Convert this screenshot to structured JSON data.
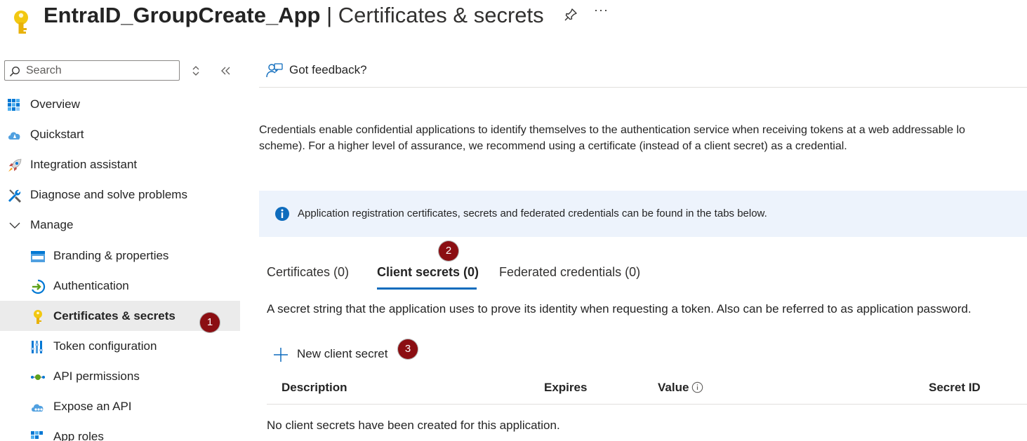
{
  "header": {
    "app_name": "EntraID_GroupCreate_App",
    "separator": " | ",
    "page_title": "Certificates & secrets",
    "more": "···",
    "icons": {
      "key": "key-icon",
      "pin": "pin-icon",
      "more": "more-icon"
    }
  },
  "sidebar": {
    "search": {
      "placeholder": "Search",
      "value": ""
    },
    "items": [
      {
        "label": "Overview",
        "icon": "overview-grid-icon"
      },
      {
        "label": "Quickstart",
        "icon": "quickstart-cloud-icon"
      },
      {
        "label": "Integration assistant",
        "icon": "rocket-icon"
      },
      {
        "label": "Diagnose and solve problems",
        "icon": "wrench-icon"
      },
      {
        "label": "Manage",
        "icon": "chevron-down-icon"
      },
      {
        "label": "Branding & properties",
        "icon": "branding-www-icon"
      },
      {
        "label": "Authentication",
        "icon": "authentication-icon"
      },
      {
        "label": "Certificates & secrets",
        "icon": "key-icon",
        "selected": true
      },
      {
        "label": "Token configuration",
        "icon": "token-bars-icon"
      },
      {
        "label": "API permissions",
        "icon": "api-permissions-icon"
      },
      {
        "label": "Expose an API",
        "icon": "cloud-api-icon"
      },
      {
        "label": "App roles",
        "icon": "app-roles-icon"
      }
    ]
  },
  "badges": {
    "one": "1",
    "two": "2",
    "three": "3"
  },
  "main": {
    "feedback": "Got feedback?",
    "description_line1": "Credentials enable confidential applications to identify themselves to the authentication service when receiving tokens at a web addressable lo",
    "description_line2": "scheme). For a higher level of assurance, we recommend using a certificate (instead of a client secret) as a credential.",
    "info": "Application registration certificates, secrets and federated credentials can be found in the tabs below.",
    "tabs": [
      {
        "label": "Certificates (0)"
      },
      {
        "label": "Client secrets (0)",
        "active": true
      },
      {
        "label": "Federated credentials (0)"
      }
    ],
    "secret_description": "A secret string that the application uses to prove its identity when requesting a token. Also can be referred to as application password.",
    "new_secret": "New client secret",
    "table": {
      "columns": [
        "Description",
        "Expires",
        "Value",
        "Secret ID"
      ],
      "empty": "No client secrets have been created for this application."
    }
  },
  "colors": {
    "accent": "#0f6cbd",
    "badge": "#8b0e12",
    "selected_bg": "#ebebeb",
    "info_bg": "#edf3fc"
  }
}
